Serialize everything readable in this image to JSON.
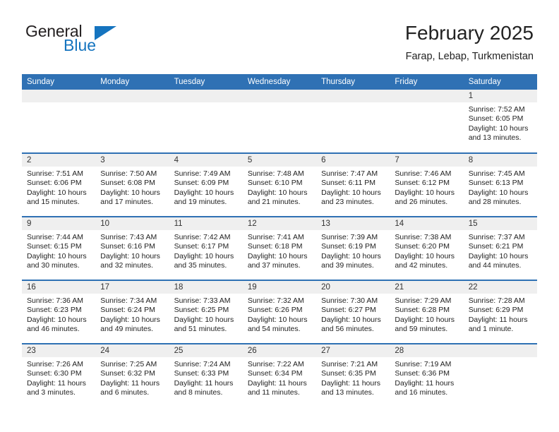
{
  "logo": {
    "word1": "General",
    "word2": "Blue",
    "triangle_color": "#1574bf",
    "text_color": "#231f20"
  },
  "header": {
    "month_title": "February 2025",
    "location": "Farap, Lebap, Turkmenistan",
    "accent_color": "#2f71b4",
    "daynum_band_color": "#efefef"
  },
  "weekday_headers": [
    "Sunday",
    "Monday",
    "Tuesday",
    "Wednesday",
    "Thursday",
    "Friday",
    "Saturday"
  ],
  "labels": {
    "sunrise": "Sunrise:",
    "sunset": "Sunset:",
    "daylight": "Daylight:"
  },
  "weeks": [
    [
      {
        "day": "",
        "empty": true
      },
      {
        "day": "",
        "empty": true
      },
      {
        "day": "",
        "empty": true
      },
      {
        "day": "",
        "empty": true
      },
      {
        "day": "",
        "empty": true
      },
      {
        "day": "",
        "empty": true
      },
      {
        "day": "1",
        "sunrise": "Sunrise: 7:52 AM",
        "sunset": "Sunset: 6:05 PM",
        "daylight": "Daylight: 10 hours and 13 minutes."
      }
    ],
    [
      {
        "day": "2",
        "sunrise": "Sunrise: 7:51 AM",
        "sunset": "Sunset: 6:06 PM",
        "daylight": "Daylight: 10 hours and 15 minutes."
      },
      {
        "day": "3",
        "sunrise": "Sunrise: 7:50 AM",
        "sunset": "Sunset: 6:08 PM",
        "daylight": "Daylight: 10 hours and 17 minutes."
      },
      {
        "day": "4",
        "sunrise": "Sunrise: 7:49 AM",
        "sunset": "Sunset: 6:09 PM",
        "daylight": "Daylight: 10 hours and 19 minutes."
      },
      {
        "day": "5",
        "sunrise": "Sunrise: 7:48 AM",
        "sunset": "Sunset: 6:10 PM",
        "daylight": "Daylight: 10 hours and 21 minutes."
      },
      {
        "day": "6",
        "sunrise": "Sunrise: 7:47 AM",
        "sunset": "Sunset: 6:11 PM",
        "daylight": "Daylight: 10 hours and 23 minutes."
      },
      {
        "day": "7",
        "sunrise": "Sunrise: 7:46 AM",
        "sunset": "Sunset: 6:12 PM",
        "daylight": "Daylight: 10 hours and 26 minutes."
      },
      {
        "day": "8",
        "sunrise": "Sunrise: 7:45 AM",
        "sunset": "Sunset: 6:13 PM",
        "daylight": "Daylight: 10 hours and 28 minutes."
      }
    ],
    [
      {
        "day": "9",
        "sunrise": "Sunrise: 7:44 AM",
        "sunset": "Sunset: 6:15 PM",
        "daylight": "Daylight: 10 hours and 30 minutes."
      },
      {
        "day": "10",
        "sunrise": "Sunrise: 7:43 AM",
        "sunset": "Sunset: 6:16 PM",
        "daylight": "Daylight: 10 hours and 32 minutes."
      },
      {
        "day": "11",
        "sunrise": "Sunrise: 7:42 AM",
        "sunset": "Sunset: 6:17 PM",
        "daylight": "Daylight: 10 hours and 35 minutes."
      },
      {
        "day": "12",
        "sunrise": "Sunrise: 7:41 AM",
        "sunset": "Sunset: 6:18 PM",
        "daylight": "Daylight: 10 hours and 37 minutes."
      },
      {
        "day": "13",
        "sunrise": "Sunrise: 7:39 AM",
        "sunset": "Sunset: 6:19 PM",
        "daylight": "Daylight: 10 hours and 39 minutes."
      },
      {
        "day": "14",
        "sunrise": "Sunrise: 7:38 AM",
        "sunset": "Sunset: 6:20 PM",
        "daylight": "Daylight: 10 hours and 42 minutes."
      },
      {
        "day": "15",
        "sunrise": "Sunrise: 7:37 AM",
        "sunset": "Sunset: 6:21 PM",
        "daylight": "Daylight: 10 hours and 44 minutes."
      }
    ],
    [
      {
        "day": "16",
        "sunrise": "Sunrise: 7:36 AM",
        "sunset": "Sunset: 6:23 PM",
        "daylight": "Daylight: 10 hours and 46 minutes."
      },
      {
        "day": "17",
        "sunrise": "Sunrise: 7:34 AM",
        "sunset": "Sunset: 6:24 PM",
        "daylight": "Daylight: 10 hours and 49 minutes."
      },
      {
        "day": "18",
        "sunrise": "Sunrise: 7:33 AM",
        "sunset": "Sunset: 6:25 PM",
        "daylight": "Daylight: 10 hours and 51 minutes."
      },
      {
        "day": "19",
        "sunrise": "Sunrise: 7:32 AM",
        "sunset": "Sunset: 6:26 PM",
        "daylight": "Daylight: 10 hours and 54 minutes."
      },
      {
        "day": "20",
        "sunrise": "Sunrise: 7:30 AM",
        "sunset": "Sunset: 6:27 PM",
        "daylight": "Daylight: 10 hours and 56 minutes."
      },
      {
        "day": "21",
        "sunrise": "Sunrise: 7:29 AM",
        "sunset": "Sunset: 6:28 PM",
        "daylight": "Daylight: 10 hours and 59 minutes."
      },
      {
        "day": "22",
        "sunrise": "Sunrise: 7:28 AM",
        "sunset": "Sunset: 6:29 PM",
        "daylight": "Daylight: 11 hours and 1 minute."
      }
    ],
    [
      {
        "day": "23",
        "sunrise": "Sunrise: 7:26 AM",
        "sunset": "Sunset: 6:30 PM",
        "daylight": "Daylight: 11 hours and 3 minutes."
      },
      {
        "day": "24",
        "sunrise": "Sunrise: 7:25 AM",
        "sunset": "Sunset: 6:32 PM",
        "daylight": "Daylight: 11 hours and 6 minutes."
      },
      {
        "day": "25",
        "sunrise": "Sunrise: 7:24 AM",
        "sunset": "Sunset: 6:33 PM",
        "daylight": "Daylight: 11 hours and 8 minutes."
      },
      {
        "day": "26",
        "sunrise": "Sunrise: 7:22 AM",
        "sunset": "Sunset: 6:34 PM",
        "daylight": "Daylight: 11 hours and 11 minutes."
      },
      {
        "day": "27",
        "sunrise": "Sunrise: 7:21 AM",
        "sunset": "Sunset: 6:35 PM",
        "daylight": "Daylight: 11 hours and 13 minutes."
      },
      {
        "day": "28",
        "sunrise": "Sunrise: 7:19 AM",
        "sunset": "Sunset: 6:36 PM",
        "daylight": "Daylight: 11 hours and 16 minutes."
      },
      {
        "day": "",
        "empty": true
      }
    ]
  ]
}
